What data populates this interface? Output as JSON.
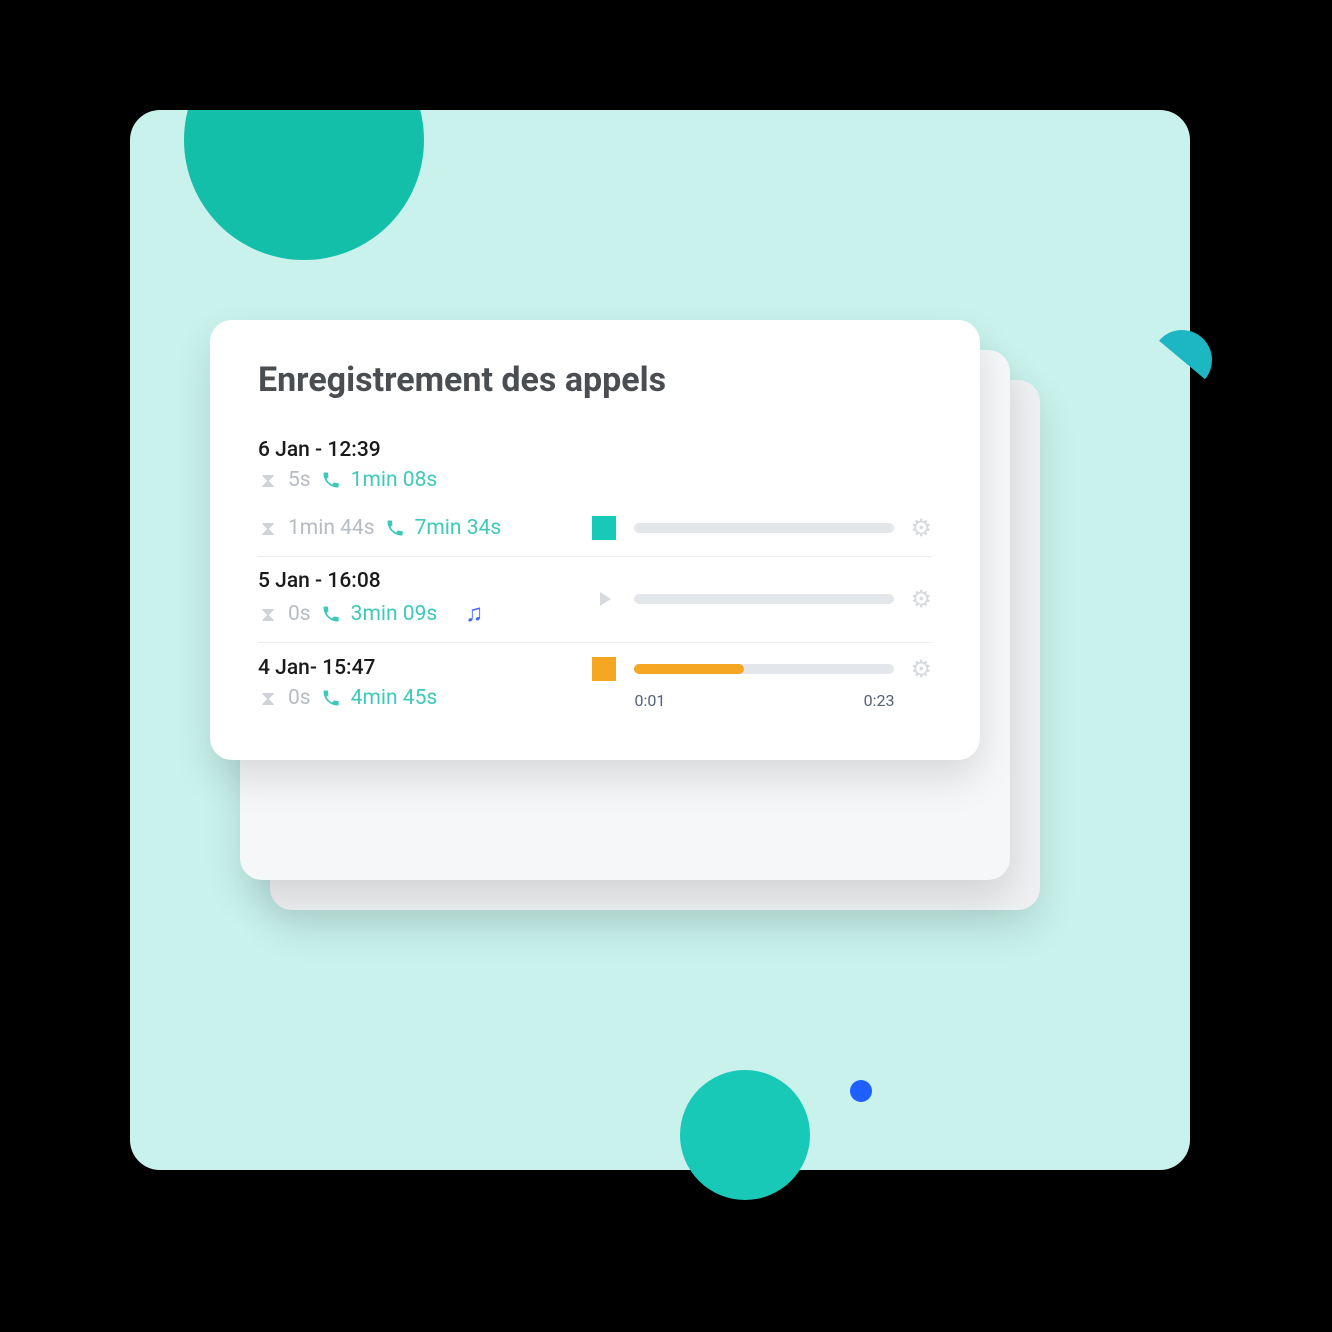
{
  "title": "Enregistrement des appels",
  "rows": [
    {
      "date": "6 Jan - 12:39",
      "wait": "5s",
      "duration": "1min 08s",
      "sub_wait": "1min 44s",
      "sub_duration": "7min 34s",
      "player": {
        "state": "stop",
        "color": "teal",
        "progress": 0
      }
    },
    {
      "date": "5 Jan - 16:08",
      "wait": "0s",
      "duration": "3min 09s",
      "music": true,
      "player": {
        "state": "play",
        "progress": 0
      }
    },
    {
      "date": "4 Jan- 15:47",
      "wait": "0s",
      "duration": "4min 45s",
      "player": {
        "state": "stop",
        "color": "orange",
        "progress": 42,
        "elapsed": "0:01",
        "total": "0:23"
      }
    }
  ]
}
